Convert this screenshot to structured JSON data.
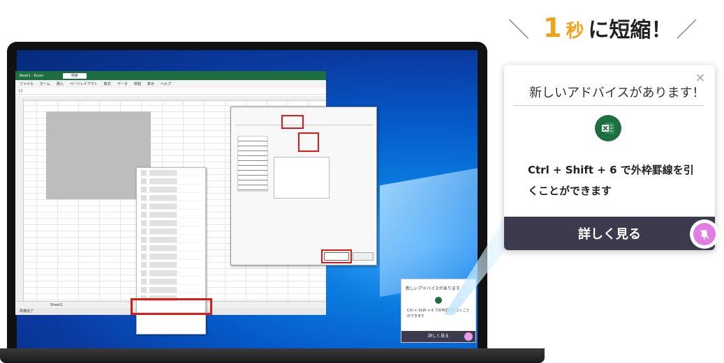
{
  "headline": {
    "slash_left": "＼",
    "number": "1",
    "unit": "秒",
    "text": "に短縮！",
    "slash_right": "／"
  },
  "popup": {
    "title": "新しいアドバイスがあります！",
    "close_glyph": "✕",
    "body": "Ctrl + Shift + 6 で外枠罫線を引くことができます",
    "button_label": "詳しく見る"
  },
  "mini_popup": {
    "title": "新しいアドバイスがあります",
    "body": "Ctrl + Shift + 6 で外枠罫線を引くことができます",
    "button_label": "詳しく見る"
  },
  "excel": {
    "title": "Book1 - Excel",
    "search": "検索",
    "menu": [
      "ファイル",
      "ホーム",
      "挿入",
      "ページレイアウト",
      "数式",
      "データ",
      "校閲",
      "表示",
      "ヘルプ"
    ],
    "name_box": "13",
    "sheet_tab": "Sheet1",
    "status": "準備完了"
  },
  "colors": {
    "headline_accent": "#f0a21a",
    "popup_footer": "#3d3a4d",
    "bell": "#e07ce2",
    "excel_green": "#1e6e42",
    "highlight_red": "#e01818"
  },
  "icons": {
    "excel": "excel-logo-icon",
    "bell": "bell-mute-icon",
    "close": "close-icon"
  }
}
